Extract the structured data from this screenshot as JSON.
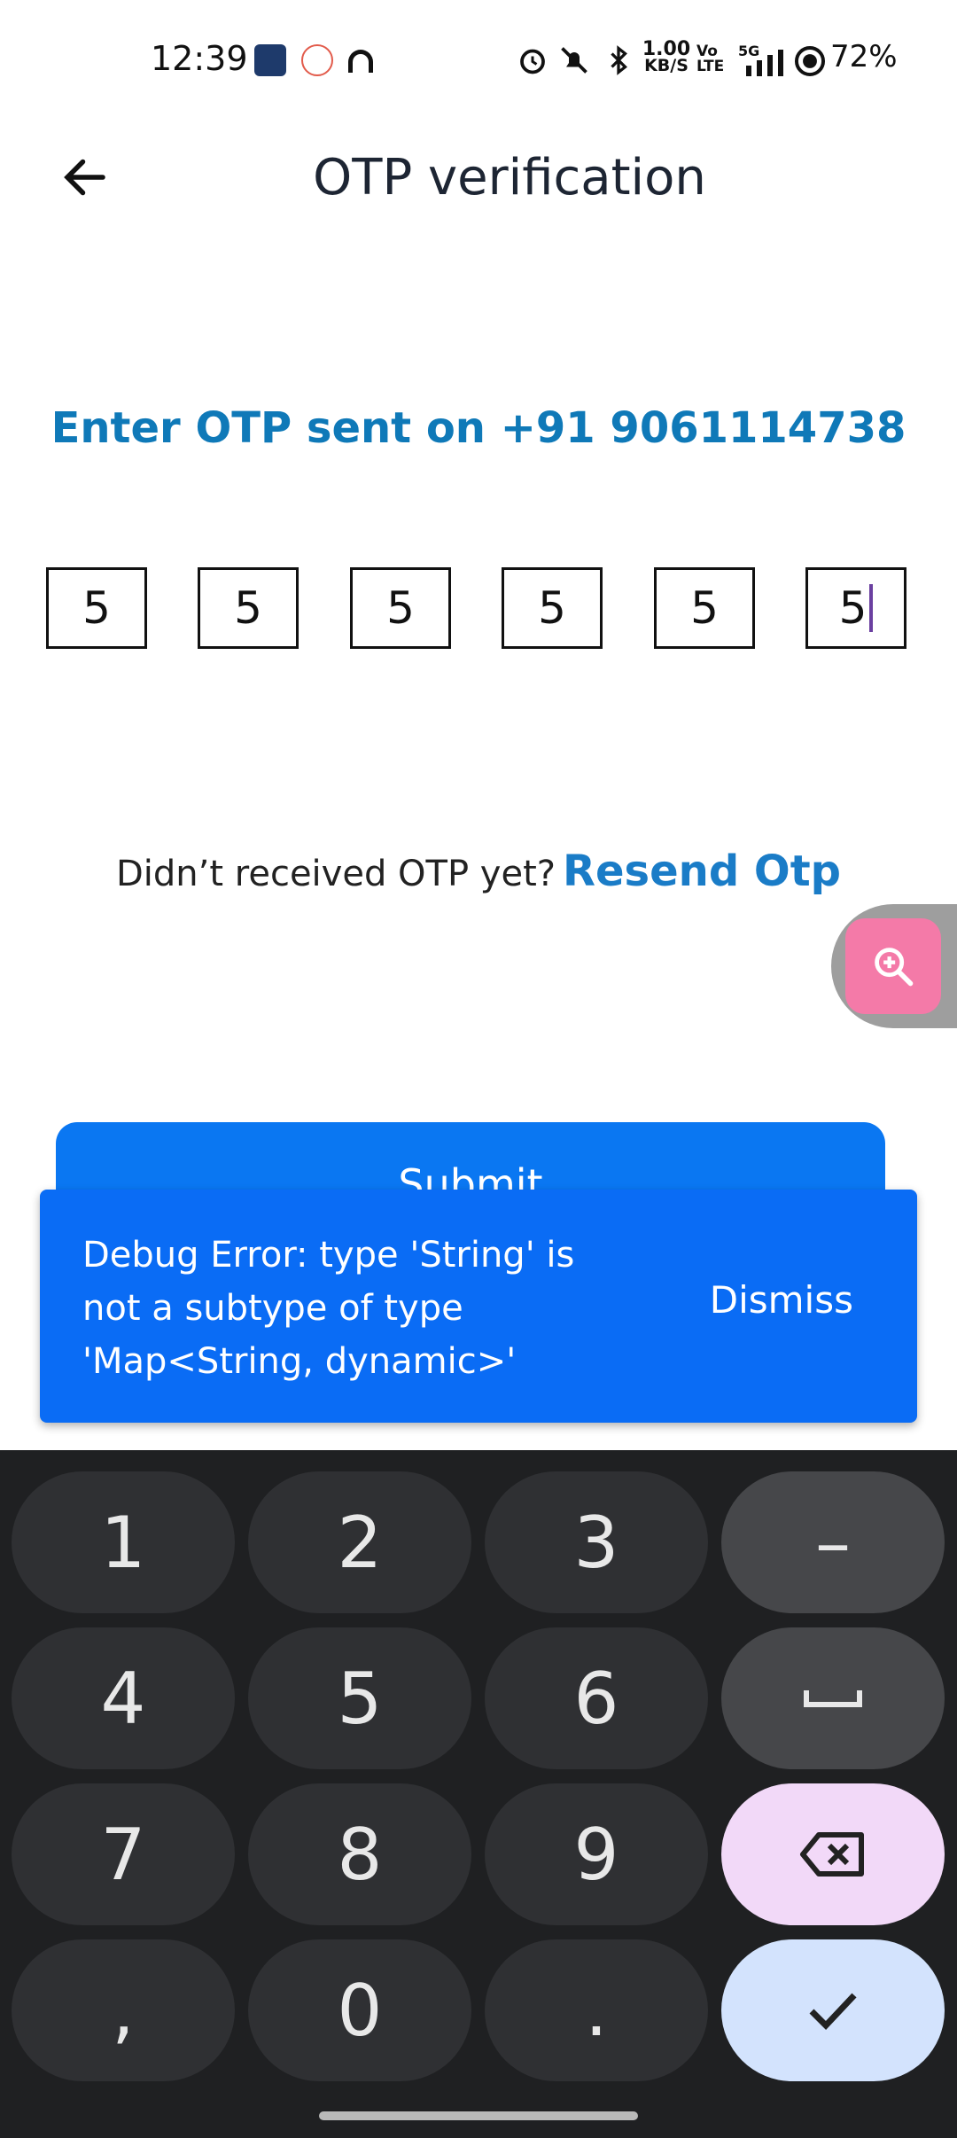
{
  "status_bar": {
    "time": "12:39",
    "net_speed_value": "1.00",
    "net_speed_unit": "KB/S",
    "volte_top": "Vo",
    "volte_bottom": "LTE",
    "network": "5G",
    "battery": "72%"
  },
  "header": {
    "title": "OTP verification"
  },
  "otp": {
    "prompt": "Enter OTP sent on +91 9061114738",
    "digits": [
      "5",
      "5",
      "5",
      "5",
      "5",
      "5"
    ]
  },
  "resend": {
    "text": "Didn’t received OTP yet?",
    "link": "Resend Otp"
  },
  "submit_label": "Submit",
  "snackbar": {
    "message": "Debug Error: type 'String' is not a subtype of type 'Map<String, dynamic>'",
    "action": "Dismiss"
  },
  "keyboard": {
    "keys": [
      "1",
      "2",
      "3",
      "–",
      "4",
      "5",
      "6",
      "␣",
      "7",
      "8",
      "9",
      "⌫",
      ",",
      "0",
      ".",
      "✓"
    ]
  },
  "colors": {
    "accent": "#0a77f2",
    "prompt": "#0f79b8",
    "link": "#1a7cc7",
    "snackbar": "#0a6cf5",
    "keyboard_bg": "#1f2022"
  }
}
